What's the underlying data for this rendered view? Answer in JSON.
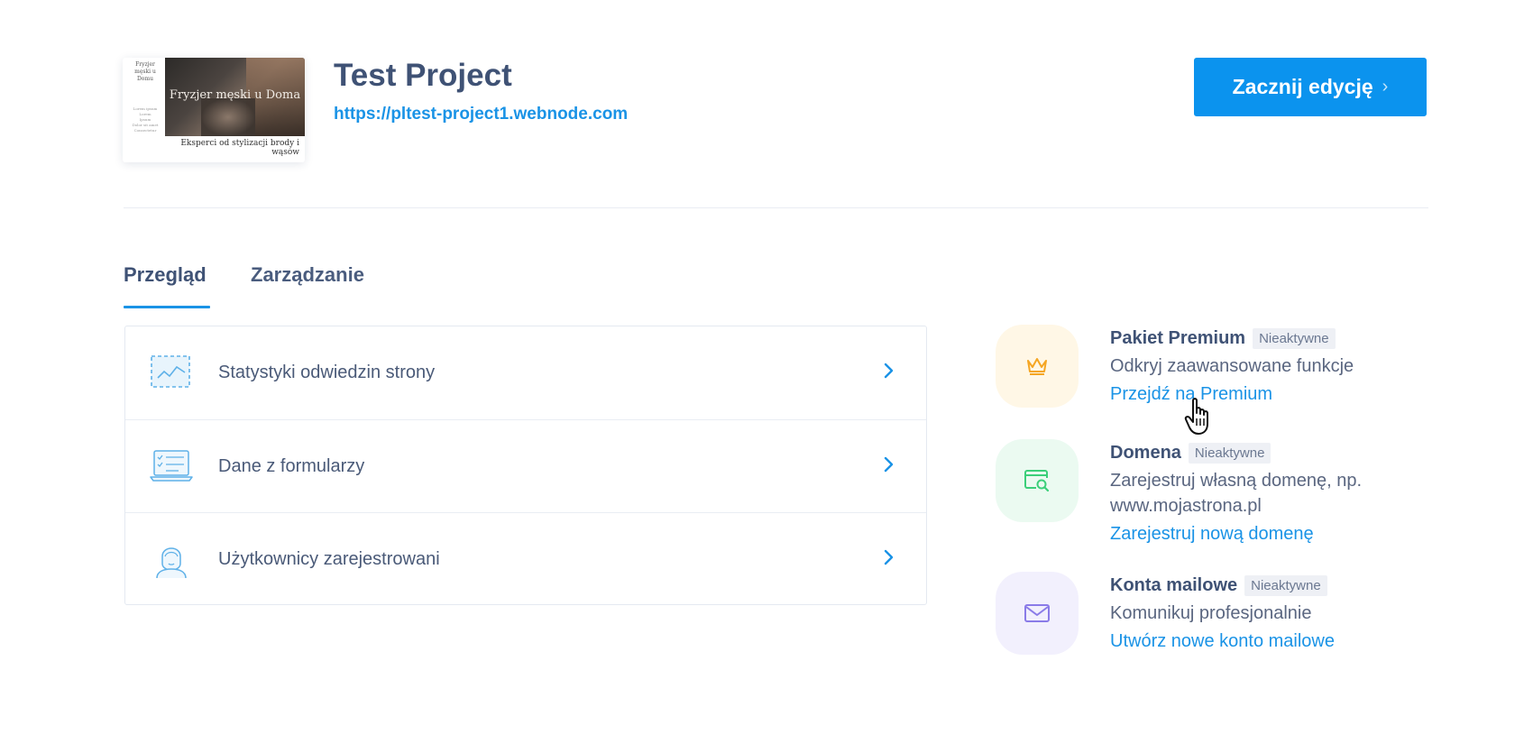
{
  "project": {
    "thumbnail": {
      "side_title": "Fryzjer męski u Domu",
      "side_menu": [
        "Lorem ipsum",
        "Lorem",
        "Ipsum",
        "Dolor sit amet",
        "Consectetur"
      ],
      "photo_title": "Fryzjer męski u Doma",
      "caption": "Eksperci od stylizacji brody i wąsów"
    },
    "title": "Test Project",
    "url": "https://pltest-project1.webnode.com"
  },
  "edit_button": {
    "label": "Zacznij edycję",
    "chevron": "›"
  },
  "tabs": [
    {
      "label": "Przegląd",
      "active": true
    },
    {
      "label": "Zarządzanie",
      "active": false
    }
  ],
  "menu_rows": [
    {
      "label": "Statystyki odwiedzin strony",
      "icon": "chart-icon"
    },
    {
      "label": "Dane z formularzy",
      "icon": "form-laptop-icon"
    },
    {
      "label": "Użytkownicy zarejestrowani",
      "icon": "user-icon"
    }
  ],
  "features": [
    {
      "name": "Pakiet Premium",
      "badge": "Nieaktywne",
      "desc_lines": [
        "Odkryj zaawansowane funkcje"
      ],
      "link": "Przejdź na Premium",
      "icon": "crown-icon",
      "bubble_color": "#fff7e6",
      "icon_color": "#f5a623"
    },
    {
      "name": "Domena",
      "badge": "Nieaktywne",
      "desc_lines": [
        "Zarejestruj własną domenę, np.",
        "www.mojastrona.pl"
      ],
      "link": "Zarejestruj nową domenę",
      "icon": "domain-search-icon",
      "bubble_color": "#ebfaf1",
      "icon_color": "#3ccf7a"
    },
    {
      "name": "Konta mailowe",
      "badge": "Nieaktywne",
      "desc_lines": [
        "Komunikuj profesjonalnie"
      ],
      "link": "Utwórz nowe konto mailowe",
      "icon": "mail-icon",
      "bubble_color": "#f2f0fd",
      "icon_color": "#8a7be8"
    }
  ],
  "colors": {
    "accent": "#1a93e6",
    "button": "#0b93ee",
    "text": "#3f5275"
  }
}
